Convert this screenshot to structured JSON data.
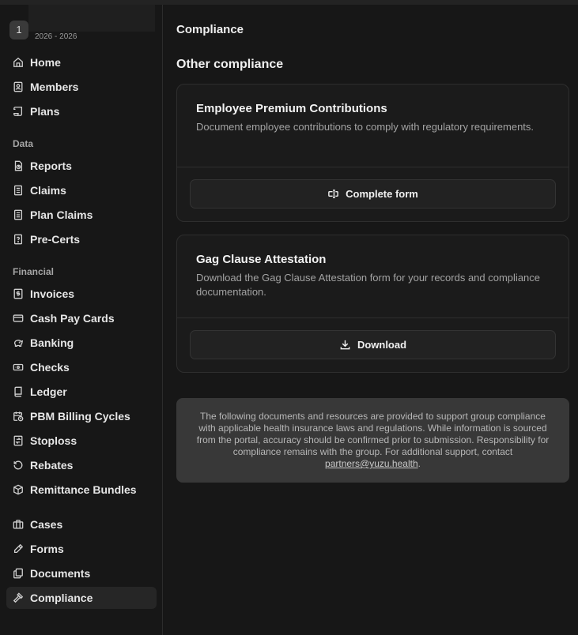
{
  "org": {
    "badge": "1",
    "year_range": "2026 - 2026"
  },
  "sidebar": {
    "main_items": [
      {
        "label": "Home",
        "icon": "home-icon"
      },
      {
        "label": "Members",
        "icon": "id-card-icon"
      },
      {
        "label": "Plans",
        "icon": "scroll-icon"
      }
    ],
    "data_label": "Data",
    "data_items": [
      {
        "label": "Reports",
        "icon": "report-icon"
      },
      {
        "label": "Claims",
        "icon": "document-icon"
      },
      {
        "label": "Plan Claims",
        "icon": "document-icon"
      },
      {
        "label": "Pre-Certs",
        "icon": "question-file-icon"
      }
    ],
    "financial_label": "Financial",
    "financial_items": [
      {
        "label": "Invoices",
        "icon": "dollar-receipt-icon"
      },
      {
        "label": "Cash Pay Cards",
        "icon": "credit-card-icon"
      },
      {
        "label": "Banking",
        "icon": "piggy-bank-icon"
      },
      {
        "label": "Checks",
        "icon": "check-icon"
      },
      {
        "label": "Ledger",
        "icon": "book-icon"
      },
      {
        "label": "PBM Billing Cycles",
        "icon": "calendar-clock-icon"
      },
      {
        "label": "Stoploss",
        "icon": "transfer-icon"
      },
      {
        "label": "Rebates",
        "icon": "rotate-icon"
      },
      {
        "label": "Remittance Bundles",
        "icon": "package-icon"
      }
    ],
    "other_items": [
      {
        "label": "Cases",
        "icon": "briefcase-icon"
      },
      {
        "label": "Forms",
        "icon": "pencil-icon"
      },
      {
        "label": "Documents",
        "icon": "files-icon"
      },
      {
        "label": "Compliance",
        "icon": "gavel-icon",
        "active": true
      }
    ]
  },
  "main": {
    "page_title": "Compliance",
    "section_title": "Other compliance",
    "cards": [
      {
        "title": "Employee Premium Contributions",
        "description": "Document employee contributions to comply with regulatory requirements.",
        "button_label": "Complete form",
        "button_icon": "form-input-icon"
      },
      {
        "title": "Gag Clause Attestation",
        "description": "Download the Gag Clause Attestation form for your records and compliance documentation.",
        "button_label": "Download",
        "button_icon": "download-icon"
      }
    ],
    "notice": {
      "text": "The following documents and resources are provided to support group compliance with applicable health insurance laws and regulations. While information is sourced from the portal, accuracy should be confirmed prior to submission. Responsibility for compliance remains with the group. For additional support, contact ",
      "email": "partners@yuzu.health",
      "suffix": "."
    }
  }
}
